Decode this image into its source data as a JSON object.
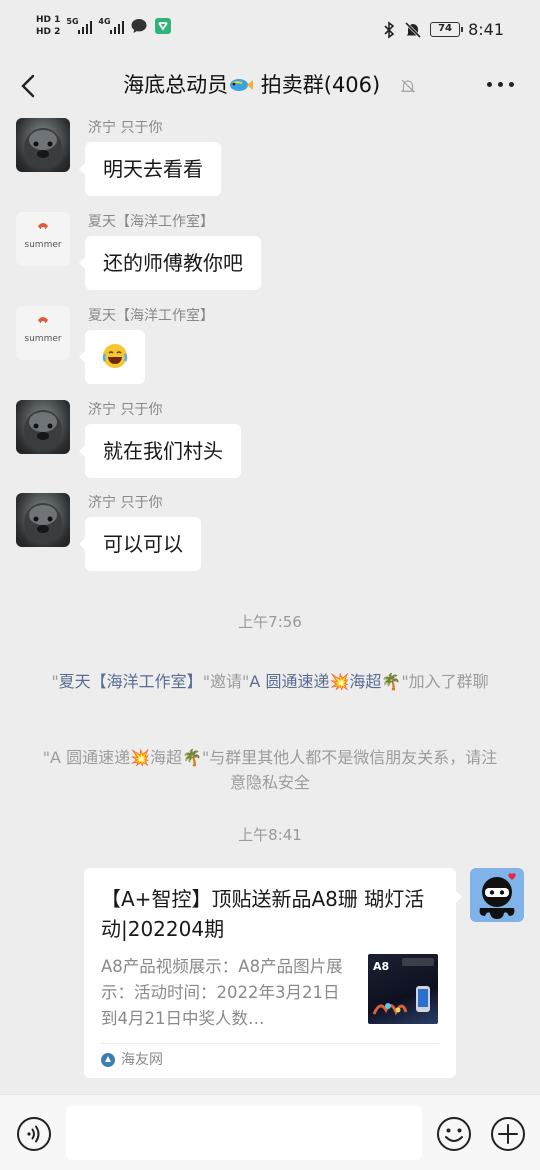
{
  "status_bar": {
    "hd1": "HD 1",
    "hd2": "HD 2",
    "net1": "5G",
    "net2": "4G",
    "battery": "74",
    "time": "8:41"
  },
  "header": {
    "title_part1": "海底总动员",
    "title_part2": " 拍卖群(406)"
  },
  "messages": [
    {
      "sender": "济宁 只于你",
      "text": "明天去看看"
    },
    {
      "sender": "夏天【海洋工作室】",
      "text": "还的师傅教你吧"
    },
    {
      "sender": "夏天【海洋工作室】",
      "text": "😂"
    },
    {
      "sender": "济宁 只于你",
      "text": "就在我们村头"
    },
    {
      "sender": "济宁 只于你",
      "text": "可以可以"
    }
  ],
  "summer_logo_text": "summer",
  "timestamps": [
    "上午7:56",
    "上午8:41"
  ],
  "system_messages": {
    "invite": {
      "q1": "\"",
      "inviter": "夏天【海洋工作室】",
      "mid": "\"邀请\"",
      "invitee": "A 圆通速递💥海超🌴",
      "end": "\"加入了群聊"
    },
    "privacy": "\"A 圆通速递💥海超🌴\"与群里其他人都不是微信朋友关系，请注意隐私安全"
  },
  "link_card": {
    "title": "【A+智控】顶贴送新品A8珊 瑚灯活动|202204期",
    "description": "A8产品视频展示：A8产品图片展示：活动时间：2022年3月21日到4月21日中奖人数…",
    "thumb_label": "A8",
    "source": "海友网"
  },
  "input_bar": {
    "placeholder": ""
  },
  "colors": {
    "background": "#ededed",
    "bubble": "#ffffff",
    "system_highlight": "#5a6d91",
    "self_avatar": "#7fb3ea"
  }
}
